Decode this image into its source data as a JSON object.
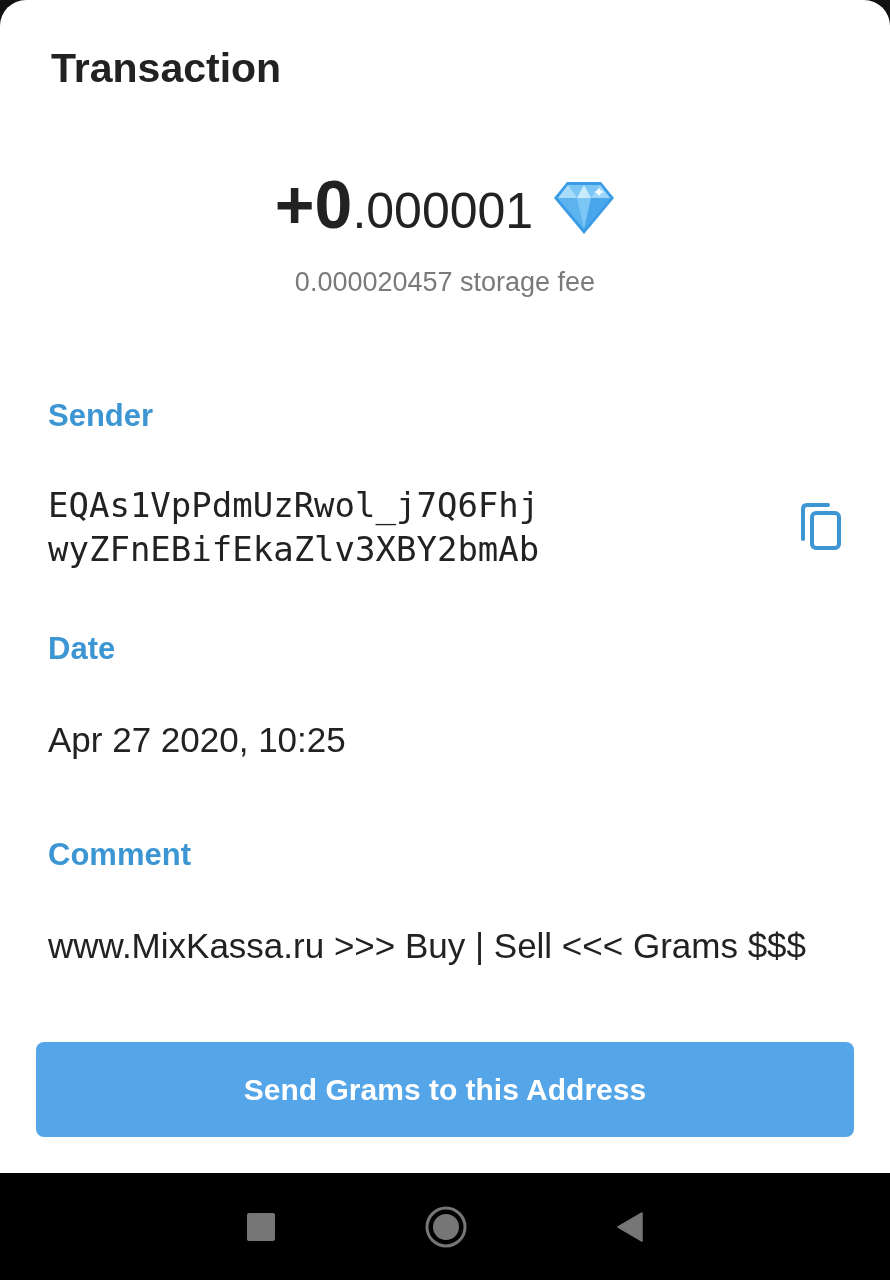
{
  "sheet": {
    "title": "Transaction"
  },
  "amount": {
    "integer": "+0",
    "fraction": ".000001",
    "fee": "0.000020457 storage fee"
  },
  "fields": [
    {
      "kind": "address",
      "label": "Sender",
      "lines": [
        "EQAs1VpPdmUzRwol_j7Q6Fhj",
        "wyZFnEBifEkaZlv3XBY2bmAb"
      ]
    },
    {
      "kind": "text",
      "label": "Date",
      "value": "Apr 27 2020, 10:25"
    },
    {
      "kind": "text",
      "label": "Comment",
      "value": "www.MixKassa.ru >>> Buy | Sell <<< Grams $$$"
    }
  ],
  "action_button": {
    "label": "Send Grams to this Address"
  }
}
